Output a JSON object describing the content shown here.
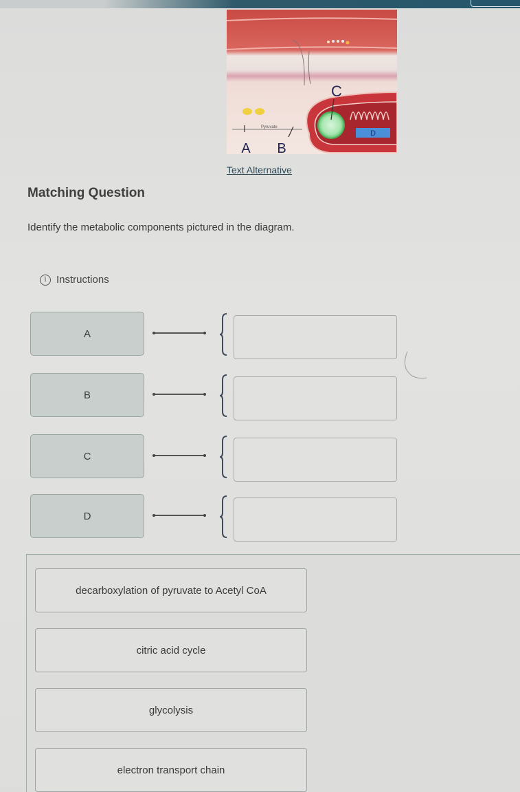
{
  "top_bar": {
    "colors": {
      "bar": "#25566b",
      "button_outline": "#d8e4e6"
    }
  },
  "diagram": {
    "labels": [
      "A",
      "B",
      "C",
      "D"
    ],
    "pyruvate_label": "Pyruvate",
    "colors": {
      "membrane_red": "#d4504a",
      "matrix_green": "#a8e6b0",
      "label_box_blue": "#4a90d9"
    }
  },
  "text_alternative_link": "Text Alternative",
  "question": {
    "title": "Matching Question",
    "prompt": "Identify the metabolic components pictured in the diagram.",
    "instructions_label": "Instructions",
    "instructions_icon": "info-icon"
  },
  "matches": [
    {
      "term": "A",
      "answer": ""
    },
    {
      "term": "B",
      "answer": ""
    },
    {
      "term": "C",
      "answer": ""
    },
    {
      "term": "D",
      "answer": ""
    }
  ],
  "choices": [
    "decarboxylation of pyruvate to Acetyl CoA",
    "citric acid cycle",
    "glycolysis",
    "electron transport chain"
  ]
}
